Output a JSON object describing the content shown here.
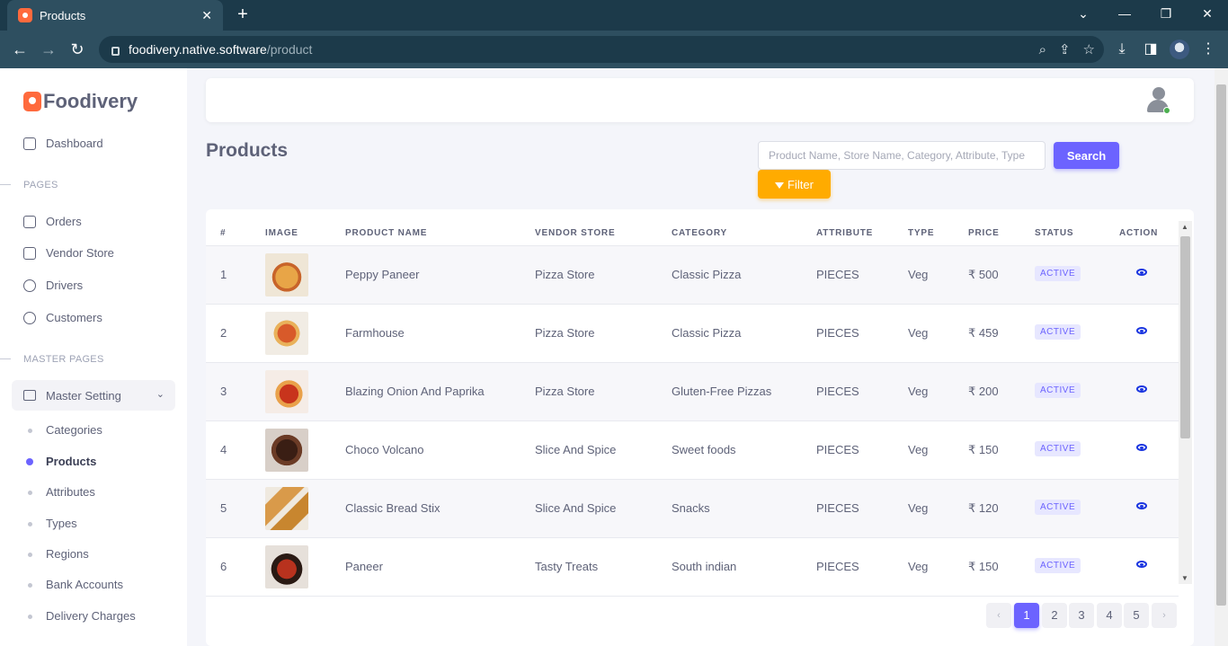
{
  "browser": {
    "tab_title": "Products",
    "url_host": "foodivery.native.software",
    "url_path": "/product"
  },
  "sidebar": {
    "brand": "Foodivery",
    "dashboard": "Dashboard",
    "pages_label": "PAGES",
    "pages": [
      "Orders",
      "Vendor Store",
      "Drivers",
      "Customers"
    ],
    "master_label": "MASTER PAGES",
    "master_setting": "Master Setting",
    "sub_items": [
      "Categories",
      "Products",
      "Attributes",
      "Types",
      "Regions",
      "Bank Accounts",
      "Delivery Charges"
    ],
    "active_item": "Products"
  },
  "main": {
    "title": "Products",
    "search_placeholder": "Product Name, Store Name, Category, Attribute, Type",
    "search_button": "Search",
    "filter_button": "Filter"
  },
  "table": {
    "headers": [
      "#",
      "IMAGE",
      "PRODUCT NAME",
      "VENDOR STORE",
      "CATEGORY",
      "ATTRIBUTE",
      "TYPE",
      "PRICE",
      "STATUS",
      "ACTION"
    ],
    "rows": [
      {
        "num": "1",
        "name": "Peppy Paneer",
        "store": "Pizza Store",
        "category": "Classic Pizza",
        "attribute": "PIECES",
        "type": "Veg",
        "price": "₹ 500",
        "status": "ACTIVE"
      },
      {
        "num": "2",
        "name": "Farmhouse",
        "store": "Pizza Store",
        "category": "Classic Pizza",
        "attribute": "PIECES",
        "type": "Veg",
        "price": "₹ 459",
        "status": "ACTIVE"
      },
      {
        "num": "3",
        "name": "Blazing Onion And Paprika",
        "store": "Pizza Store",
        "category": "Gluten-Free Pizzas",
        "attribute": "PIECES",
        "type": "Veg",
        "price": "₹ 200",
        "status": "ACTIVE"
      },
      {
        "num": "4",
        "name": "Choco Volcano",
        "store": "Slice And Spice",
        "category": "Sweet foods",
        "attribute": "PIECES",
        "type": "Veg",
        "price": "₹ 150",
        "status": "ACTIVE"
      },
      {
        "num": "5",
        "name": "Classic Bread Stix",
        "store": "Slice And Spice",
        "category": "Snacks",
        "attribute": "PIECES",
        "type": "Veg",
        "price": "₹ 120",
        "status": "ACTIVE"
      },
      {
        "num": "6",
        "name": "Paneer",
        "store": "Tasty Treats",
        "category": "South indian",
        "attribute": "PIECES",
        "type": "Veg",
        "price": "₹ 150",
        "status": "ACTIVE"
      }
    ]
  },
  "pagination": {
    "prev": "‹",
    "pages": [
      "1",
      "2",
      "3",
      "4",
      "5"
    ],
    "next": "›",
    "current": "1"
  },
  "colors": {
    "primary": "#6c63ff",
    "filter": "#ffab00",
    "brand": "#ff6a3d",
    "browser": "#1c3a4a"
  }
}
